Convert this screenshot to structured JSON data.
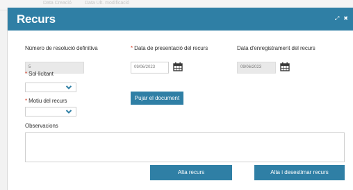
{
  "background": {
    "hint_left": "Data Creació",
    "hint_right": "Data Ult. modificació"
  },
  "modal": {
    "title": "Recurs",
    "header_color": "#2f7fa5",
    "icons": [
      "expand-icon",
      "close-icon"
    ]
  },
  "form": {
    "resolution_number": {
      "label": "Número de resolució definitiva",
      "value": "5"
    },
    "submission_date": {
      "required_mark": "*",
      "label": "Data de presentació del recurs",
      "value": "09/06/2023"
    },
    "registration_date": {
      "label": "Data d'enregistrament del recurs",
      "value": "09/06/2023"
    },
    "applicant": {
      "required_mark": "*",
      "label": "Sol·licitant",
      "value": ""
    },
    "reason": {
      "required_mark": "*",
      "label": "Motiu del recurs",
      "value": ""
    },
    "upload_button": "Pujar el document",
    "observations": {
      "label": "Observacions",
      "value": ""
    }
  },
  "actions": {
    "register": "Alta recurs",
    "register_dismiss": "Alta i desestimar recurs"
  }
}
